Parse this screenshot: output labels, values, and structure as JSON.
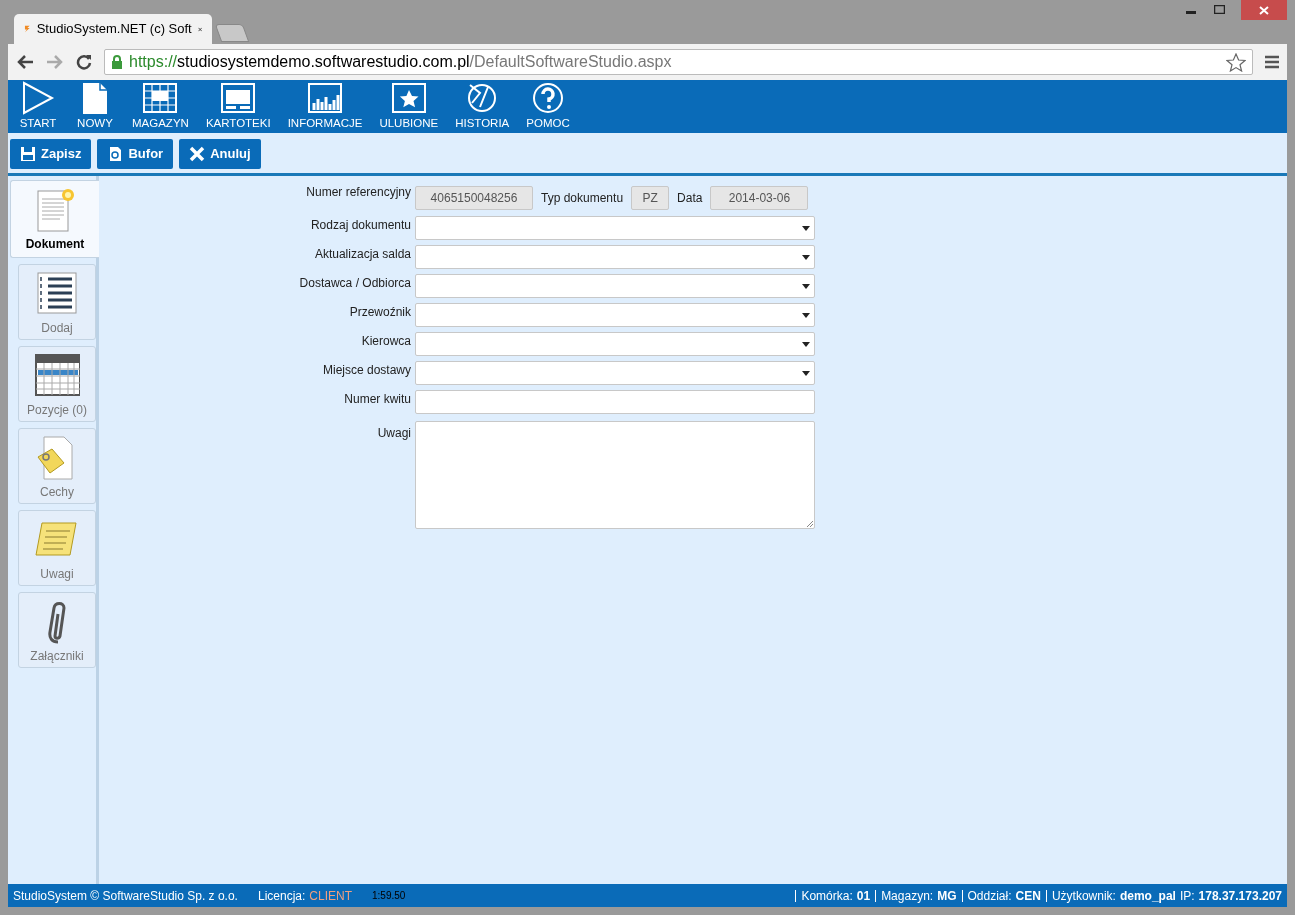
{
  "browser": {
    "tab_title": "StudioSystem.NET (c) Soft",
    "url_scheme": "https://",
    "url_host": "studiosystemdemo.softwarestudio.com.pl",
    "url_path": "/DefaultSoftwareStudio.aspx"
  },
  "nav": [
    {
      "label": "START",
      "kind": "play"
    },
    {
      "label": "NOWY",
      "kind": "page"
    },
    {
      "label": "MAGAZYN",
      "kind": "grid"
    },
    {
      "label": "KARTOTEKI",
      "kind": "window"
    },
    {
      "label": "INFORMACJE",
      "kind": "chart"
    },
    {
      "label": "ULUBIONE",
      "kind": "star"
    },
    {
      "label": "HISTORIA",
      "kind": "history"
    },
    {
      "label": "POMOC",
      "kind": "help"
    }
  ],
  "toolbar": [
    {
      "label": "Zapisz",
      "kind": "save"
    },
    {
      "label": "Bufor",
      "kind": "buffer"
    },
    {
      "label": "Anuluj",
      "kind": "cancel"
    }
  ],
  "sidebar": [
    {
      "label": "Dokument",
      "kind": "document",
      "selected": true
    },
    {
      "label": "Dodaj",
      "kind": "list",
      "selected": false
    },
    {
      "label": "Pozycje (0)",
      "kind": "table",
      "selected": false
    },
    {
      "label": "Cechy",
      "kind": "note",
      "selected": false
    },
    {
      "label": "Uwagi",
      "kind": "memo",
      "selected": false
    },
    {
      "label": "Załączniki",
      "kind": "clip",
      "selected": false
    }
  ],
  "form": {
    "header": [
      {
        "label": "Numer referencyjny",
        "value": "4065150048256"
      },
      {
        "label": "Typ dokumentu",
        "value": "PZ"
      },
      {
        "label": "Data",
        "value": "2014-03-06"
      }
    ],
    "rows": [
      {
        "label": "Rodzaj dokumentu",
        "kind": "select"
      },
      {
        "label": "Aktualizacja salda",
        "kind": "select"
      },
      {
        "label": "Dostawca / Odbiorca",
        "kind": "select"
      },
      {
        "label": "Przewoźnik",
        "kind": "select"
      },
      {
        "label": "Kierowca",
        "kind": "select"
      },
      {
        "label": "Miejsce dostawy",
        "kind": "select"
      },
      {
        "label": "Numer kwitu",
        "kind": "text"
      },
      {
        "label": "Uwagi",
        "kind": "textarea"
      }
    ]
  },
  "status_bar": {
    "copyright": "StudioSystem © SoftwareStudio Sp. z o.o.",
    "license_label": "Licencja:",
    "license_value": "CLIENT",
    "timer": "1:59.50",
    "items": [
      {
        "label": "Komórka:",
        "value": "01",
        "separator": true
      },
      {
        "label": "Magazyn:",
        "value": "MG",
        "separator": true
      },
      {
        "label": "Oddział:",
        "value": "CEN",
        "separator": true
      },
      {
        "label": "Użytkownik:",
        "value": "demo_pal",
        "separator": true
      },
      {
        "label": "IP:",
        "value": "178.37.173.207",
        "separator": false
      }
    ]
  }
}
